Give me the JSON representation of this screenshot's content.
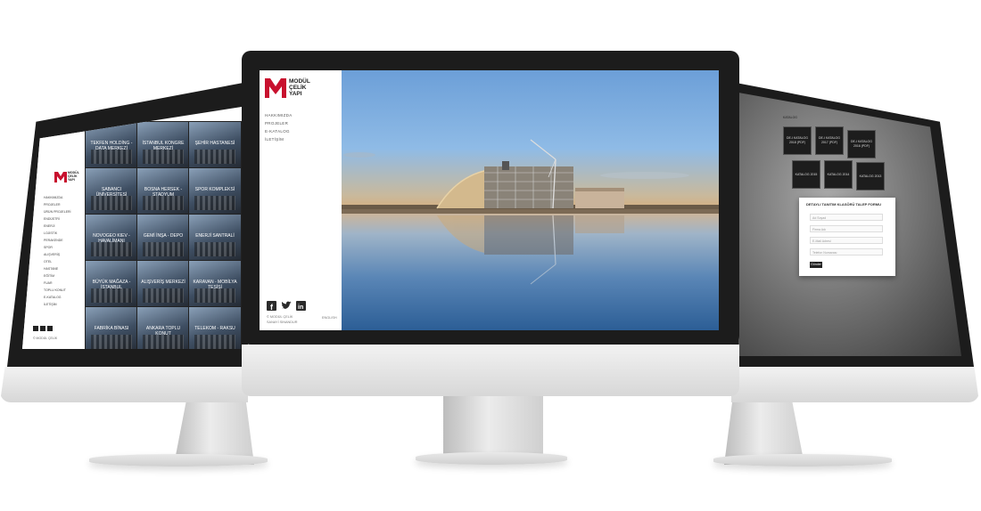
{
  "center": {
    "logo_lines": [
      "MODÜL",
      "ÇELİK",
      "YAPI"
    ],
    "nav": [
      "HAKKIMIZDA",
      "PROJELER",
      "E-KATALOG",
      "İLETİŞİM"
    ],
    "footer_copyright": "© MODÜL ÇELİK",
    "footer_sub": "SANAYİ SINANDUR",
    "language": "ENGLISH",
    "social_icons": [
      "facebook-icon",
      "twitter-icon",
      "linkedin-icon"
    ]
  },
  "left": {
    "logo_lines": [
      "MODÜL",
      "ÇELİK",
      "YAPI"
    ],
    "nav": [
      "HAKKIMIZDA",
      "PROJELER",
      "ÜRÜN PROJELERİ",
      "ENDÜSTRİ",
      "ENERJİ",
      "LOJİSTİK",
      "PERAKENDE",
      "SPOR",
      "ALIŞVERİŞ",
      "OTEL",
      "HASTANE",
      "EĞİTİM",
      "FUAR",
      "TOPLU KONUT",
      "E-KATALOG",
      "İLETİŞİM"
    ],
    "tiles": [
      {
        "label": "TEKFEN HOLDİNG - DATA MERKEZİ"
      },
      {
        "label": "İSTANBUL KONGRE MERKEZİ"
      },
      {
        "label": "ŞEHİR HASTANESİ"
      },
      {
        "label": "SABANCI ÜNİVERSİTESİ"
      },
      {
        "label": "BOSNA HERSEK - STADYUM"
      },
      {
        "label": "SPOR KOMPLEKSİ"
      },
      {
        "label": "NOVOGEO KIEV - HAVALİMANI"
      },
      {
        "label": "GEMİ İNŞA - DEPO"
      },
      {
        "label": "ENERJİ SANTRALİ"
      },
      {
        "label": "BÜYÜK MAĞAZA - İSTANBUL"
      },
      {
        "label": "ALIŞVERİŞ MERKEZİ"
      },
      {
        "label": "KARAVAN - MOBİLYA TESİSİ"
      },
      {
        "label": "FABRİKA BİNASI"
      },
      {
        "label": "ANKARA TOPLU KONUT"
      },
      {
        "label": "TELEKOM - RAKSU"
      }
    ],
    "footer": "© MODÜL ÇELİK"
  },
  "right": {
    "catalog_buttons": [
      "DE-I KATALOG 2018 (PDF)",
      "DE-I KATALOG 2017 (PDF)",
      "DE-I KATALOG 2016 (PDF)",
      "KATALOG 2015",
      "KATALOG 2014",
      "KATALOG 2013"
    ],
    "form_title": "DETAYLI TANITIM KLASÖRÜ TALEP FORMU",
    "form_fields": [
      "Ad Soyad",
      "Firma Adı",
      "E-Mail Adresi",
      "Telefon Numarası"
    ],
    "submit_label": "Gönder"
  },
  "colors": {
    "brand_red": "#c8102e",
    "bezel": "#1c1c1c",
    "chin": "#e3e3e3"
  }
}
